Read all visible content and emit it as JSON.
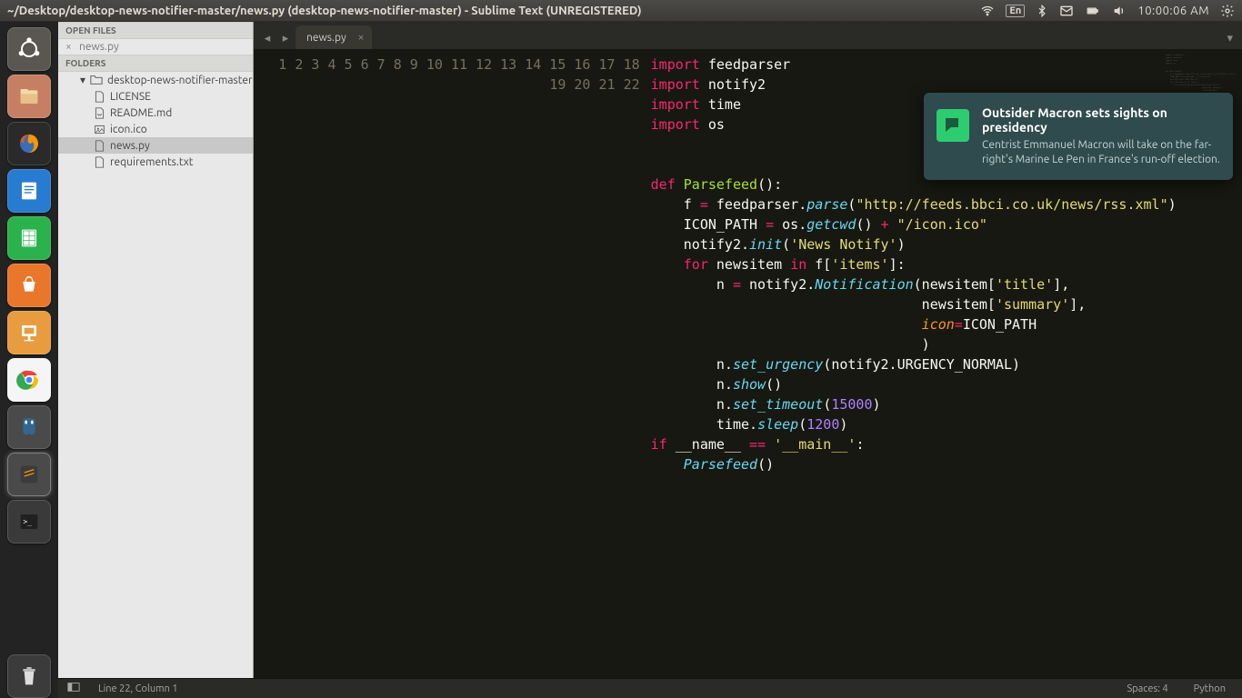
{
  "menubar": {
    "title": "~/Desktop/desktop-news-notifier-master/news.py (desktop-news-notifier-master) - Sublime Text (UNREGISTERED)",
    "kbd": "En",
    "clock": "10:00:06 AM"
  },
  "launcher": {
    "items": [
      {
        "name": "ubuntu-dash",
        "color": "#4a4a4a"
      },
      {
        "name": "nautilus-files",
        "color": "#9e5a46"
      },
      {
        "name": "firefox",
        "color": "#2a2a2a"
      },
      {
        "name": "libreoffice-writer",
        "color": "#1675c9"
      },
      {
        "name": "libreoffice-calc",
        "color": "#1fa81f"
      },
      {
        "name": "ubuntu-software",
        "color": "#e8772b"
      },
      {
        "name": "libreoffice-impress",
        "color": "#d9822b"
      },
      {
        "name": "google-chrome",
        "color": "#f0f0f0"
      },
      {
        "name": "postgresql",
        "color": "#4a4a4a"
      },
      {
        "name": "sublime-text",
        "color": "#4a4a4a"
      },
      {
        "name": "terminal",
        "color": "#3a3a3a"
      }
    ],
    "trash": {
      "name": "trash",
      "color": "rgba(255,255,255,0.1)"
    }
  },
  "sidebar": {
    "open_header": "OPEN FILES",
    "open_files": [
      {
        "dirty": "×",
        "name": "news.py"
      }
    ],
    "folders_header": "FOLDERS",
    "root": {
      "name": "desktop-news-notifier-master"
    },
    "files": [
      {
        "name": "LICENSE",
        "icon": "file"
      },
      {
        "name": "README.md",
        "icon": "markdown"
      },
      {
        "name": "icon.ico",
        "icon": "image"
      },
      {
        "name": "news.py",
        "icon": "file",
        "selected": true
      },
      {
        "name": "requirements.txt",
        "icon": "file"
      }
    ]
  },
  "tabs": {
    "active": {
      "name": "news.py"
    }
  },
  "code": {
    "lines": [
      {
        "n": 1,
        "html": "<span class='kw'>import</span> <span class='pl'>feedparser</span>"
      },
      {
        "n": 2,
        "html": "<span class='kw'>import</span> <span class='pl'>notify2</span>"
      },
      {
        "n": 3,
        "html": "<span class='kw'>import</span> <span class='pl'>time</span>"
      },
      {
        "n": 4,
        "html": "<span class='kw'>import</span> <span class='pl'>os</span>"
      },
      {
        "n": 5,
        "html": ""
      },
      {
        "n": 6,
        "html": ""
      },
      {
        "n": 7,
        "html": "<span class='kw'>def</span> <span class='nm'>Parsefeed</span>():"
      },
      {
        "n": 8,
        "html": "    f <span class='op'>=</span> feedparser.<span class='fn'>parse</span>(<span class='st'>\"http://feeds.bbci.co.uk/news/rss.xml\"</span>)"
      },
      {
        "n": 9,
        "html": "    ICON_PATH <span class='op'>=</span> os.<span class='fn'>getcwd</span>() <span class='op'>+</span> <span class='st'>\"/icon.ico\"</span>"
      },
      {
        "n": 10,
        "html": "    notify2.<span class='fn'>init</span>(<span class='st'>'News Notify'</span>)"
      },
      {
        "n": 11,
        "html": "    <span class='kw'>for</span> newsitem <span class='kw'>in</span> f[<span class='st'>'items'</span>]:"
      },
      {
        "n": 12,
        "html": "        n <span class='op'>=</span> notify2.<span class='cl'>Notification</span>(newsitem[<span class='st'>'title'</span>],"
      },
      {
        "n": 13,
        "html": "                                 newsitem[<span class='st'>'summary'</span>],"
      },
      {
        "n": 14,
        "html": "                                 <span class='pa'>icon</span><span class='op'>=</span>ICON_PATH"
      },
      {
        "n": 15,
        "html": "                                 )"
      },
      {
        "n": 16,
        "html": "        n.<span class='fn'>set_urgency</span>(notify2.URGENCY_NORMAL)"
      },
      {
        "n": 17,
        "html": "        n.<span class='fn'>show</span>()"
      },
      {
        "n": 18,
        "html": "        n.<span class='fn'>set_timeout</span>(<span class='nb'>15000</span>)"
      },
      {
        "n": 19,
        "html": "        time.<span class='fn'>sleep</span>(<span class='nb'>1200</span>)"
      },
      {
        "n": 20,
        "html": "<span class='kw'>if</span> __name__ <span class='op'>==</span> <span class='st'>'__main__'</span>:"
      },
      {
        "n": 21,
        "html": "    <span class='fn'>Parsefeed</span>()"
      },
      {
        "n": 22,
        "html": ""
      }
    ]
  },
  "statusbar": {
    "pos": "Line 22, Column 1",
    "spaces": "Spaces: 4",
    "syntax": "Python"
  },
  "notification": {
    "title": "Outsider Macron sets sights on presidency",
    "body": "Centrist Emmanuel Macron will take on the far-right's Marine Le Pen in France's run-off election."
  }
}
